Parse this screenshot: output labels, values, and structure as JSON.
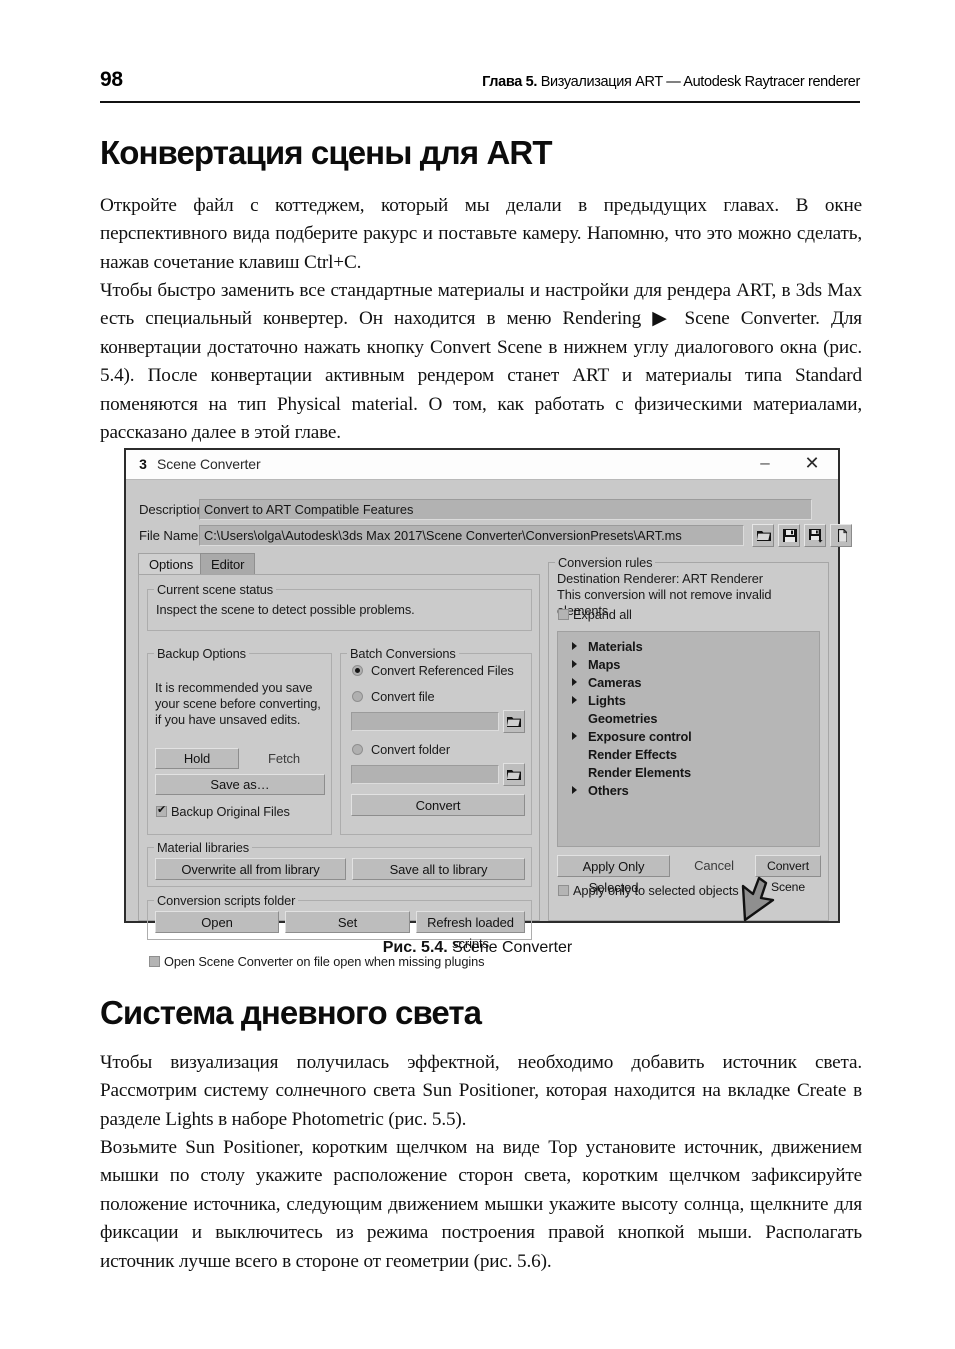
{
  "page": {
    "folio": "98",
    "running_head_bold": "Глава 5.",
    "running_head_rest": " Визуализация ART — Autodesk Raytracer renderer"
  },
  "headings": {
    "h1": "Конвертация сцены для ART",
    "h2": "Система дневного света"
  },
  "paragraphs": {
    "p1": "Откройте файл с коттеджем, который мы делали в предыдущих главах. В окне перспективного вида подберите ракурс и поставьте камеру. Напомню, что это можно сделать, нажав сочетание клавиш Ctrl+C.",
    "p2": "Чтобы быстро заменить все стандартные материалы и настройки для рендера ART, в 3ds Max есть специальный конвертер. Он находится в меню Rendering ▶ Scene Converter. Для конвертации достаточно нажать кнопку Convert Scene в нижнем углу диалогового окна (рис. 5.4). После конвертации активным рендером станет ART и материалы типа Standard поменяются на тип Physical material. О том, как работать с физическими материалами, рассказано далее в этой главе.",
    "p3": "Чтобы визуализация получилась эффектной, необходимо добавить источник света. Рассмотрим систему солнечного света Sun Positioner, которая находится на вкладке Create в разделе Lights в наборе Photometric (рис. 5.5).",
    "p4": "Возьмите Sun Positioner, коротким щелчком на виде Top установите источник, движением мышки по столу укажите расположение сторон света, коротким щелчком зафиксируйте положение источника, следующим движением мышки укажите высоту солнца, щелкните для фиксации и выключитесь из режима построения правой кнопкой мыши. Располагать источник лучше всего в стороне от геометрии (рис. 5.6)."
  },
  "figure": {
    "caption_bold": "Рис. 5.4.",
    "caption_rest": " Scene Converter"
  },
  "dialog": {
    "title": "Scene Converter",
    "app_icon_text": "3",
    "minimize": "–",
    "close": "✕",
    "description_label": "Description",
    "description_value": "Convert to ART Compatible Features",
    "filename_label": "File Name",
    "filename_value": "C:\\Users\\olga\\Autodesk\\3ds Max 2017\\Scene Converter\\ConversionPresets\\ART.ms",
    "tabs": [
      {
        "label": "Options",
        "active": true
      },
      {
        "label": "Editor",
        "active": false
      }
    ],
    "scene_status": {
      "group_title": "Current scene status",
      "text": "Inspect the scene to detect possible problems."
    },
    "backup": {
      "group_title": "Backup Options",
      "note": "It is recommended you save your scene before converting, if you have unsaved edits.",
      "hold_label": "Hold",
      "fetch_label": "Fetch",
      "save_as_label": "Save as…",
      "checkbox_label": "Backup Original Files",
      "checkbox_checked": true
    },
    "batch": {
      "group_title": "Batch Conversions",
      "radio_referenced": "Convert Referenced Files",
      "radio_file": "Convert file",
      "radio_folder": "Convert folder",
      "file_value": "",
      "folder_value": "",
      "convert_label": "Convert",
      "selected": "Convert Referenced Files"
    },
    "material_libraries": {
      "group_title": "Material libraries",
      "overwrite_label": "Overwrite all from library",
      "save_all_label": "Save all to library"
    },
    "scripts_folder": {
      "group_title": "Conversion scripts folder",
      "open_label": "Open",
      "set_label": "Set",
      "refresh_label": "Refresh loaded scripts"
    },
    "open_on_missing_plugins": {
      "label": "Open Scene Converter on file open when missing plugins",
      "checked": false
    },
    "conversion_rules": {
      "group_title": "Conversion rules",
      "destination_renderer": "Destination Renderer: ART Renderer",
      "note": "This conversion will not remove invalid elements.",
      "expand_all_label": "Expand all",
      "expand_all_checked": false,
      "items": [
        {
          "label": "Materials",
          "expandable": true
        },
        {
          "label": "Maps",
          "expandable": true
        },
        {
          "label": "Cameras",
          "expandable": true
        },
        {
          "label": "Lights",
          "expandable": true
        },
        {
          "label": "Geometries",
          "expandable": false
        },
        {
          "label": "Exposure control",
          "expandable": true
        },
        {
          "label": "Render Effects",
          "expandable": false
        },
        {
          "label": "Render Elements",
          "expandable": false
        },
        {
          "label": "Others",
          "expandable": true
        }
      ]
    },
    "footer": {
      "apply_only_selected_label": "Apply Only Selected",
      "cancel_label": "Cancel",
      "convert_scene_label": "Convert Scene",
      "apply_only_to_selected_objects_label": "Apply only to selected objects",
      "apply_only_to_selected_objects_checked": false
    },
    "toolbar_icons": [
      "open-folder-icon",
      "save-icon",
      "save-as-icon",
      "new-document-icon"
    ]
  }
}
